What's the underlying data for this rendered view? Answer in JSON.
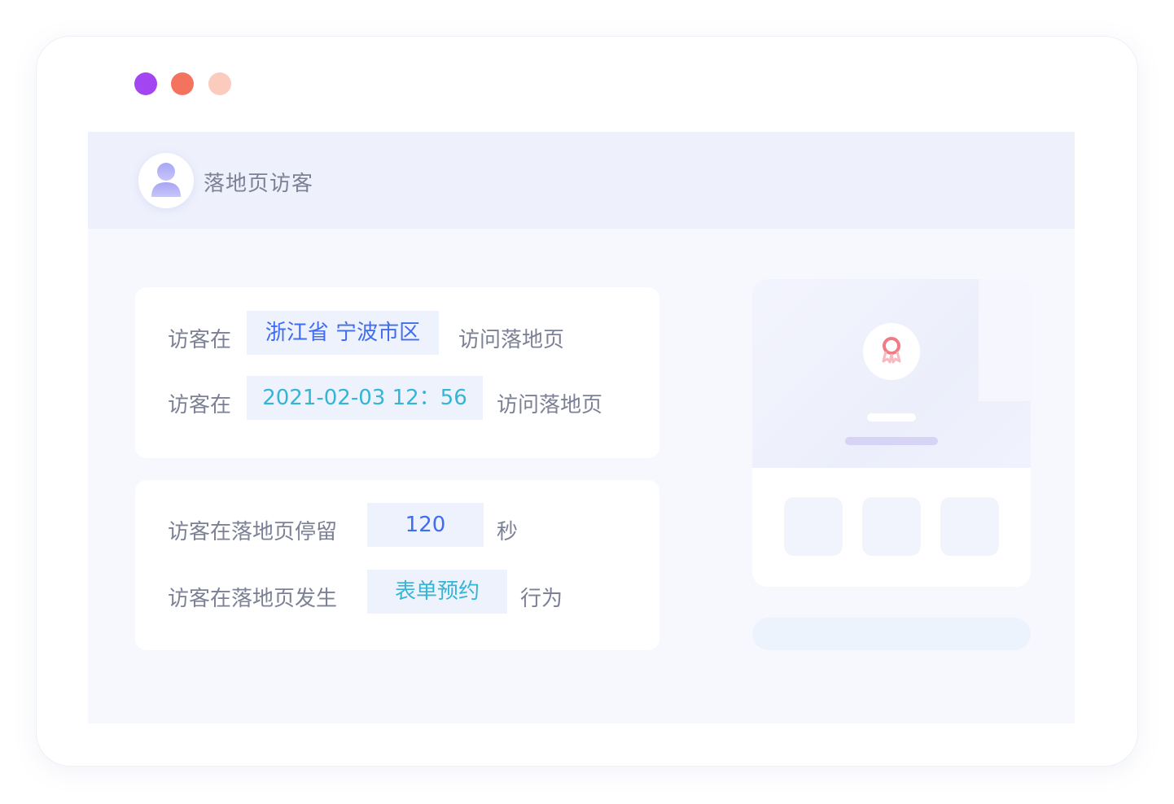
{
  "window": {
    "dots": [
      {
        "name": "purple",
        "color": "#a445f2"
      },
      {
        "name": "coral",
        "color": "#f4735f"
      },
      {
        "name": "peach",
        "color": "#fbcbbd"
      }
    ]
  },
  "header": {
    "title": "落地页访客",
    "avatar_icon": "user-icon"
  },
  "card1": {
    "row1": {
      "prefix": "访客在",
      "value": "浙江省  宁波市区",
      "suffix": "访问落地页"
    },
    "row2": {
      "prefix": "访客在",
      "value": "2021-02-03  12：56",
      "suffix": "访问落地页"
    }
  },
  "card2": {
    "row1": {
      "prefix": "访客在落地页停留",
      "value": "120",
      "suffix": "秒"
    },
    "row2": {
      "prefix": "访客在落地页发生",
      "value": "表单预约",
      "suffix": "行为"
    }
  },
  "phone": {
    "badge_icon": "award-icon",
    "tiles": 3
  },
  "colors": {
    "accent_blue": "#3f6cf0",
    "accent_cyan": "#35b5d6",
    "header_bg": "#eef0fc",
    "content_bg": "#f7f8fd",
    "text_gray": "#7d8196"
  }
}
